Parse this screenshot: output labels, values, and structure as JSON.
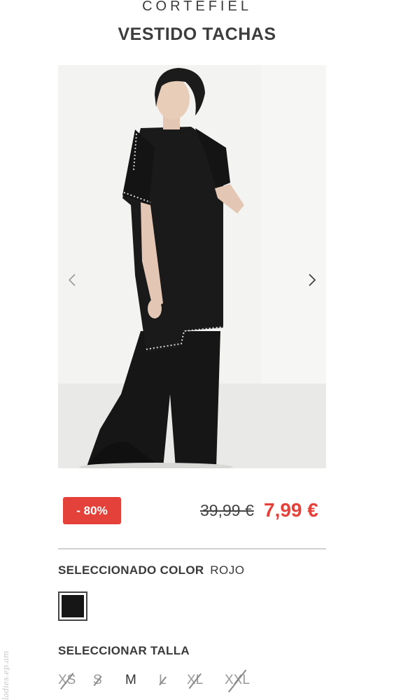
{
  "header": {
    "brand": "CORTEFIEL",
    "product_title": "VESTIDO TACHAS"
  },
  "gallery": {
    "prev_icon": "chevron-left-icon",
    "next_icon": "chevron-right-icon"
  },
  "pricing": {
    "discount_badge": "- 80%",
    "old_price": "39,99 €",
    "new_price": "7,99 €",
    "accent_color": "#e4413a"
  },
  "color": {
    "label": "SELECCIONADO COLOR",
    "value": "ROJO",
    "swatch_color": "#161616"
  },
  "size": {
    "label": "SELECCIONAR TALLA",
    "options": [
      {
        "label": "XS",
        "available": false
      },
      {
        "label": "S",
        "available": false
      },
      {
        "label": "M",
        "available": true
      },
      {
        "label": "L",
        "available": false
      },
      {
        "label": "XL",
        "available": false
      },
      {
        "label": "XXL",
        "available": false
      }
    ]
  },
  "watermark": "ladies.ep.am"
}
